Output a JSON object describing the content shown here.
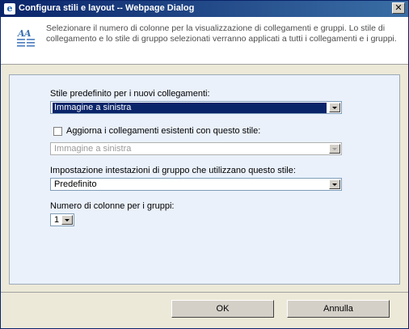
{
  "window": {
    "title": "Configura stili e layout -- Webpage Dialog",
    "close_glyph": "✕"
  },
  "header": {
    "description": "Selezionare il numero di colonne per la visualizzazione di collegamenti e gruppi. Lo stile di collegamento e lo stile di gruppo selezionati verranno applicati a tutti i collegamenti e i gruppi."
  },
  "form": {
    "default_style_label": "Stile predefinito per i nuovi collegamenti:",
    "default_style_value": "Immagine a sinistra",
    "update_existing_label": "Aggiorna i collegamenti esistenti con questo stile:",
    "update_existing_checked": false,
    "update_existing_value": "Immagine a sinistra",
    "group_heading_label": "Impostazione intestazioni di gruppo che utilizzano questo stile:",
    "group_heading_value": "Predefinito",
    "columns_label": "Numero di colonne per i gruppi:",
    "columns_value": "1"
  },
  "buttons": {
    "ok": "OK",
    "cancel": "Annulla"
  },
  "colors": {
    "titlebar": "#0a246a",
    "panel_bg": "#eaf1fb",
    "selection": "#0a246a"
  }
}
